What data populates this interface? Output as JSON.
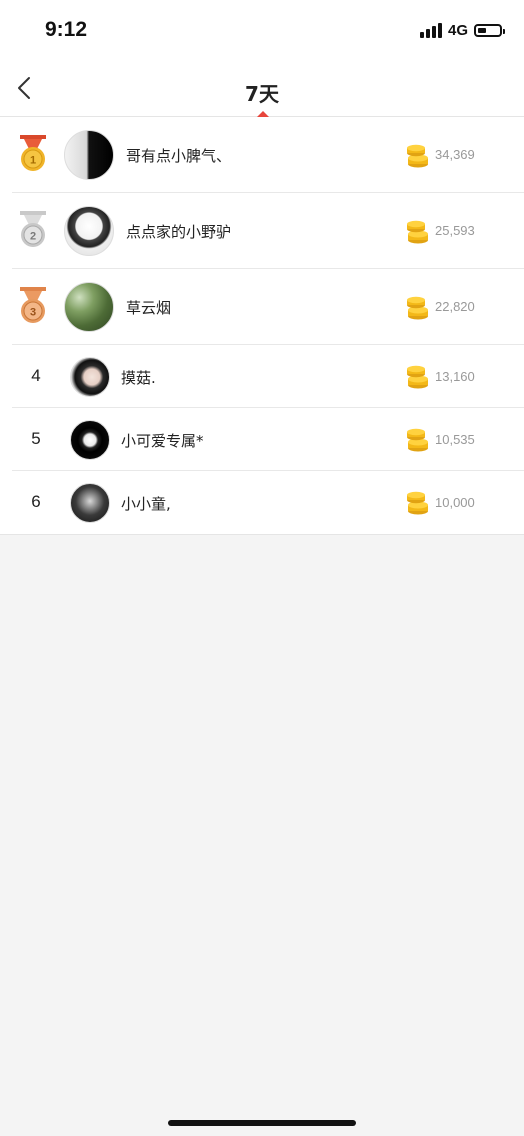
{
  "status_bar": {
    "time": "9:12",
    "network": "4G"
  },
  "nav": {
    "title": "7天"
  },
  "ranking": [
    {
      "rank": "1",
      "name": "哥有点小脾气、",
      "score": "34,369",
      "medal": "gold"
    },
    {
      "rank": "2",
      "name": "点点家的小野驴",
      "score": "25,593",
      "medal": "silver"
    },
    {
      "rank": "3",
      "name": "草云烟",
      "score": "22,820",
      "medal": "bronze"
    },
    {
      "rank": "4",
      "name": "摸菇.",
      "score": "13,160"
    },
    {
      "rank": "5",
      "name": "小可爱专属*",
      "score": "10,535"
    },
    {
      "rank": "6",
      "name": "小小童,",
      "score": "10,000"
    }
  ],
  "colors": {
    "accent": "#e8453c",
    "gold": "#f0b429",
    "silver": "#c8c8c8",
    "bronze": "#e79a5f"
  }
}
